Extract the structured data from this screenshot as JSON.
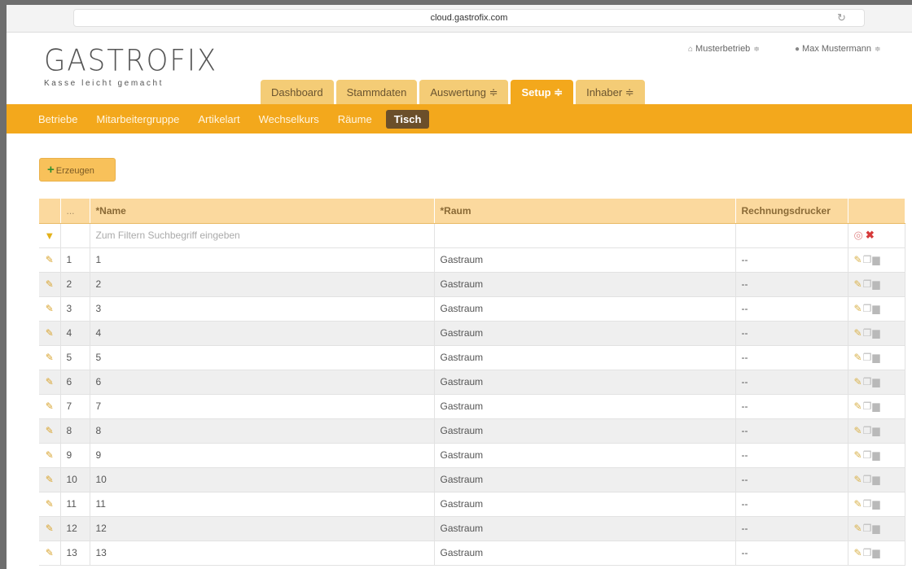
{
  "browser": {
    "url": "cloud.gastrofix.com",
    "reload_icon": "reload-icon"
  },
  "brand": {
    "logo": "GASTROFIX",
    "tagline": "Kasse leicht gemacht"
  },
  "header": {
    "company": "Musterbetrieb",
    "user": "Max Mustermann",
    "company_icon": "home-icon",
    "user_icon": "user-icon"
  },
  "main_tabs": [
    {
      "label": "Dashboard"
    },
    {
      "label": "Stammdaten"
    },
    {
      "label": "Auswertung ≑"
    },
    {
      "label": "Setup ≑"
    },
    {
      "label": "Inhaber ≑"
    }
  ],
  "sub_nav": [
    {
      "label": "Betriebe"
    },
    {
      "label": "Mitarbeitergruppe"
    },
    {
      "label": "Artikelart"
    },
    {
      "label": "Wechselkurs"
    },
    {
      "label": "Räume"
    },
    {
      "label": "Tisch"
    }
  ],
  "toolbar": {
    "create_label": "Erzeugen"
  },
  "table": {
    "columns": {
      "num": "...",
      "name": "*Name",
      "room": "*Raum",
      "printer": "Rechnungsdrucker"
    },
    "filter_placeholder": "Zum Filtern Suchbegriff eingeben",
    "rows": [
      {
        "num": "1",
        "name": "1",
        "room": "Gastraum",
        "printer": "--"
      },
      {
        "num": "2",
        "name": "2",
        "room": "Gastraum",
        "printer": "--"
      },
      {
        "num": "3",
        "name": "3",
        "room": "Gastraum",
        "printer": "--"
      },
      {
        "num": "4",
        "name": "4",
        "room": "Gastraum",
        "printer": "--"
      },
      {
        "num": "5",
        "name": "5",
        "room": "Gastraum",
        "printer": "--"
      },
      {
        "num": "6",
        "name": "6",
        "room": "Gastraum",
        "printer": "--"
      },
      {
        "num": "7",
        "name": "7",
        "room": "Gastraum",
        "printer": "--"
      },
      {
        "num": "8",
        "name": "8",
        "room": "Gastraum",
        "printer": "--"
      },
      {
        "num": "9",
        "name": "9",
        "room": "Gastraum",
        "printer": "--"
      },
      {
        "num": "10",
        "name": "10",
        "room": "Gastraum",
        "printer": "--"
      },
      {
        "num": "11",
        "name": "11",
        "room": "Gastraum",
        "printer": "--"
      },
      {
        "num": "12",
        "name": "12",
        "room": "Gastraum",
        "printer": "--"
      },
      {
        "num": "13",
        "name": "13",
        "room": "Gastraum",
        "printer": "--"
      }
    ]
  },
  "colors": {
    "accent": "#f3a81c",
    "tab_inactive": "#f4cc76",
    "active_subnav": "#6b4f2a",
    "header_row": "#fbd99e"
  }
}
